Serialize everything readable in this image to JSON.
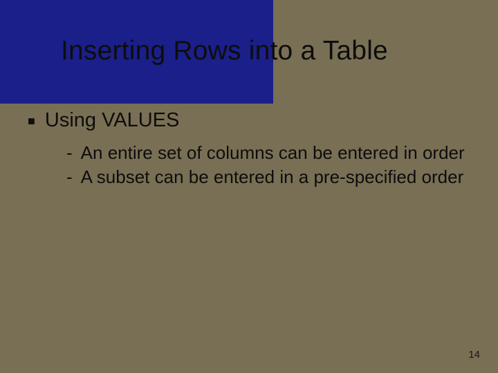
{
  "slide": {
    "title": "Inserting Rows into a Table",
    "bullet_symbol": "■",
    "bullet_1": "Using VALUES",
    "dash": "-",
    "sub_1": "An entire set of columns can be entered in order",
    "sub_2": "A subset can be entered in a pre-specified order",
    "page_number": "14"
  }
}
